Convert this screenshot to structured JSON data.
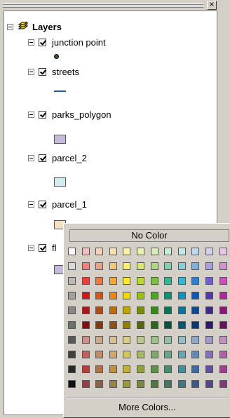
{
  "toc": {
    "root_label": "Layers",
    "layers": [
      {
        "label": "junction point",
        "symbol": "point",
        "color": "#3a5a2a"
      },
      {
        "label": "streets",
        "symbol": "line",
        "color": "#1f5fa8"
      },
      {
        "label": "parks_polygon",
        "symbol": "fill",
        "color": "#c8b8dc"
      },
      {
        "label": "parcel_2",
        "symbol": "fill",
        "color": "#d4ecf0"
      },
      {
        "label": "parcel_1",
        "symbol": "fill",
        "color": "#f5dfc0"
      },
      {
        "label": "fl",
        "symbol": "fill",
        "color": "#c8b8dc"
      }
    ]
  },
  "color_picker": {
    "no_color_label": "No Color",
    "more_colors_label": "More Colors...",
    "palette": [
      [
        "#ffffff",
        "#f0c0c0",
        "#f8d0b8",
        "#f8e0b0",
        "#f8f0b0",
        "#e8f0b8",
        "#d8ecc0",
        "#c8ecd8",
        "#c0e8e8",
        "#c0d8f0",
        "#d0d0f0",
        "#e8c8e8"
      ],
      [
        "#d8d8d8",
        "#f08080",
        "#f0a080",
        "#f8c870",
        "#f8f070",
        "#d8e878",
        "#b0d888",
        "#80d0b0",
        "#80d0e0",
        "#80b0e0",
        "#a8a0e0",
        "#d890d0"
      ],
      [
        "#b8b8b8",
        "#e84040",
        "#f07838",
        "#f8a830",
        "#f8e830",
        "#b8d838",
        "#78c048",
        "#30b890",
        "#30b8d8",
        "#3080d0",
        "#7060c8",
        "#c850b8"
      ],
      [
        "#a0a0a0",
        "#d01818",
        "#e05010",
        "#f08800",
        "#f0d800",
        "#98c010",
        "#48a820",
        "#009870",
        "#0098c8",
        "#1058b8",
        "#5038a8",
        "#b02898"
      ],
      [
        "#888888",
        "#a81818",
        "#b84810",
        "#c07000",
        "#c0a800",
        "#788c10",
        "#388820",
        "#007858",
        "#0078a0",
        "#104890",
        "#402888",
        "#881878"
      ],
      [
        "#707070",
        "#801010",
        "#883808",
        "#905010",
        "#908000",
        "#586810",
        "#286818",
        "#005840",
        "#005878",
        "#083870",
        "#301868",
        "#681060"
      ],
      [
        "#585858",
        "#c89090",
        "#d0a888",
        "#d8c090",
        "#d8d088",
        "#b8c890",
        "#a0c090",
        "#90c0a8",
        "#90c0c8",
        "#90a8c8",
        "#a098c8",
        "#c090c0"
      ],
      [
        "#404040",
        "#c06060",
        "#c88860",
        "#d0a860",
        "#d0c858",
        "#a8b860",
        "#80a868",
        "#60a888",
        "#60a8b8",
        "#6088b8",
        "#8070b8",
        "#b060a8"
      ],
      [
        "#282828",
        "#b04040",
        "#b87040",
        "#c09040",
        "#c0b040",
        "#90a040",
        "#609048",
        "#409070",
        "#4090a0",
        "#4068a0",
        "#6050a0",
        "#984090"
      ],
      [
        "#101010",
        "#904040",
        "#906040",
        "#988040",
        "#989840",
        "#788840",
        "#507840",
        "#407860",
        "#407888",
        "#405888",
        "#504888",
        "#803878"
      ]
    ]
  }
}
